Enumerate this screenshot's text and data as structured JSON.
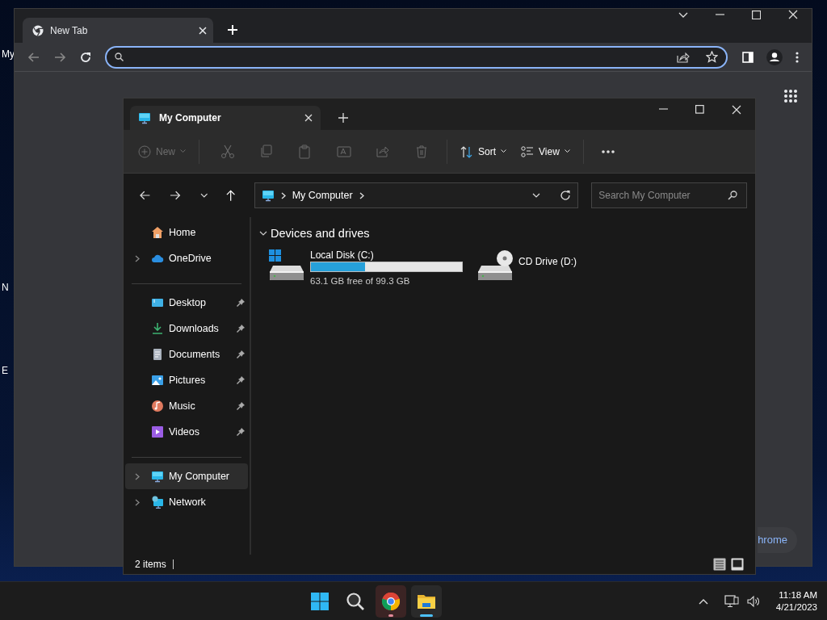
{
  "desktop": {
    "icon_labels": [
      "My",
      "N",
      "E"
    ]
  },
  "browser": {
    "tabs": [
      {
        "title": "New Tab",
        "selected": true
      }
    ],
    "customize_button": "hrome"
  },
  "explorer": {
    "tabs": [
      {
        "title": "My Computer",
        "selected": true
      }
    ],
    "toolbar": [
      {
        "kind": "menu",
        "label": "New",
        "disabled": true
      },
      {
        "kind": "icon",
        "disabled": true
      },
      {
        "kind": "icon",
        "disabled": true
      },
      {
        "kind": "icon",
        "disabled": true
      },
      {
        "kind": "icon",
        "disabled": true
      },
      {
        "kind": "icon",
        "disabled": true
      },
      {
        "kind": "icon",
        "disabled": true
      },
      {
        "kind": "menu",
        "label": "Sort",
        "disabled": false
      },
      {
        "kind": "menu",
        "label": "View",
        "disabled": false
      },
      {
        "kind": "more",
        "disabled": false
      }
    ],
    "breadcrumb": [
      "My Computer"
    ],
    "search": {
      "placeholder": "Search My Computer"
    },
    "sidebar": [
      [
        {
          "label": "Home",
          "expandable": false,
          "pinned": false,
          "selected": false
        },
        {
          "label": "OneDrive",
          "expandable": true,
          "pinned": false,
          "selected": false
        }
      ],
      [
        {
          "label": "Desktop",
          "expandable": false,
          "pinned": true,
          "selected": false
        },
        {
          "label": "Downloads",
          "expandable": false,
          "pinned": true,
          "selected": false
        },
        {
          "label": "Documents",
          "expandable": false,
          "pinned": true,
          "selected": false
        },
        {
          "label": "Pictures",
          "expandable": false,
          "pinned": true,
          "selected": false
        },
        {
          "label": "Music",
          "expandable": false,
          "pinned": true,
          "selected": false
        },
        {
          "label": "Videos",
          "expandable": false,
          "pinned": true,
          "selected": false
        }
      ],
      [
        {
          "label": "My Computer",
          "expandable": true,
          "pinned": false,
          "selected": true
        },
        {
          "label": "Network",
          "expandable": true,
          "pinned": false,
          "selected": false
        }
      ]
    ],
    "section": {
      "title": "Devices and drives",
      "expanded": true
    },
    "drives": [
      {
        "kind": "disk",
        "name": "Local Disk (C:)",
        "level": 0.36,
        "free": "63.1 GB free of 99.3 GB"
      },
      {
        "kind": "cd",
        "name": "CD Drive (D:)"
      }
    ],
    "status": {
      "count": "2 items"
    }
  },
  "taskbar": {
    "apps": [
      {
        "kind": "start"
      },
      {
        "kind": "search"
      },
      {
        "kind": "chrome",
        "running": true,
        "active": false
      },
      {
        "kind": "explorer",
        "running": true,
        "active": true
      }
    ],
    "clock": {
      "time": "11:18 AM",
      "date": "4/21/2023"
    }
  }
}
